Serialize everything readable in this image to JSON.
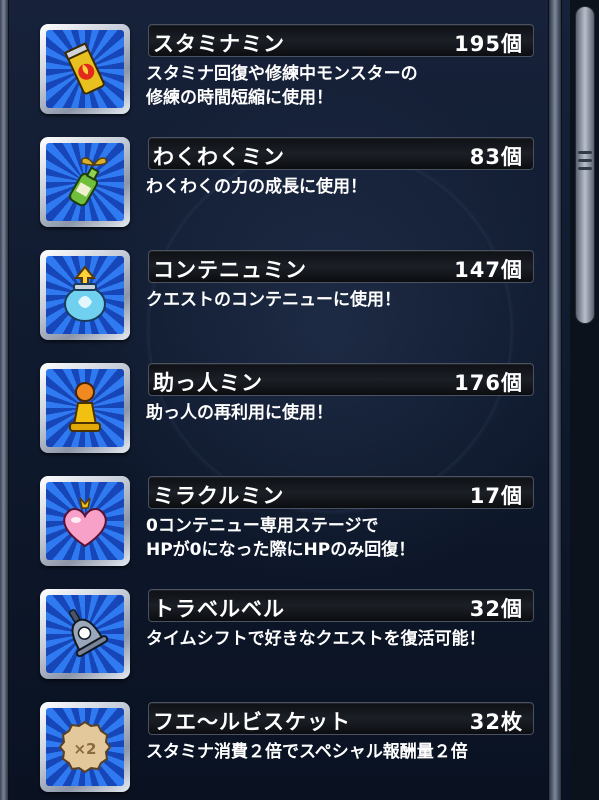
{
  "items": [
    {
      "name": "スタミナミン",
      "quantity": "195個",
      "desc_line1": "スタミナ回復や修練中モンスターの",
      "desc_line2": "修練の時間短縮に使用！",
      "icon": "stamina-can-icon"
    },
    {
      "name": "わくわくミン",
      "quantity": "83個",
      "desc_line1": "わくわくの力の成長に使用！",
      "desc_line2": "",
      "icon": "sprout-bottle-icon"
    },
    {
      "name": "コンテニュミン",
      "quantity": "147個",
      "desc_line1": "クエストのコンテニューに使用！",
      "desc_line2": "",
      "icon": "continue-jar-icon"
    },
    {
      "name": "助っ人ミン",
      "quantity": "176個",
      "desc_line1": "助っ人の再利用に使用！",
      "desc_line2": "",
      "icon": "helper-pawn-icon"
    },
    {
      "name": "ミラクルミン",
      "quantity": "17個",
      "desc_line1": "0コンテニュー専用ステージで",
      "desc_line2": "HPが0になった際にHPのみ回復！",
      "icon": "heart-potion-icon"
    },
    {
      "name": "トラベルベル",
      "quantity": "32個",
      "desc_line1": "タイムシフトで好きなクエストを復活可能！",
      "desc_line2": "",
      "icon": "bell-icon"
    },
    {
      "name": "フエ〜ルビスケット",
      "quantity": "32枚",
      "desc_line1": "スタミナ消費２倍でスペシャル報酬量２倍",
      "desc_line2": "",
      "icon": "biscuit-icon"
    }
  ],
  "colors": {
    "icon_bg_dark": "#1746b8",
    "icon_bg_light": "#2f7af0",
    "text": "#ffffff"
  }
}
